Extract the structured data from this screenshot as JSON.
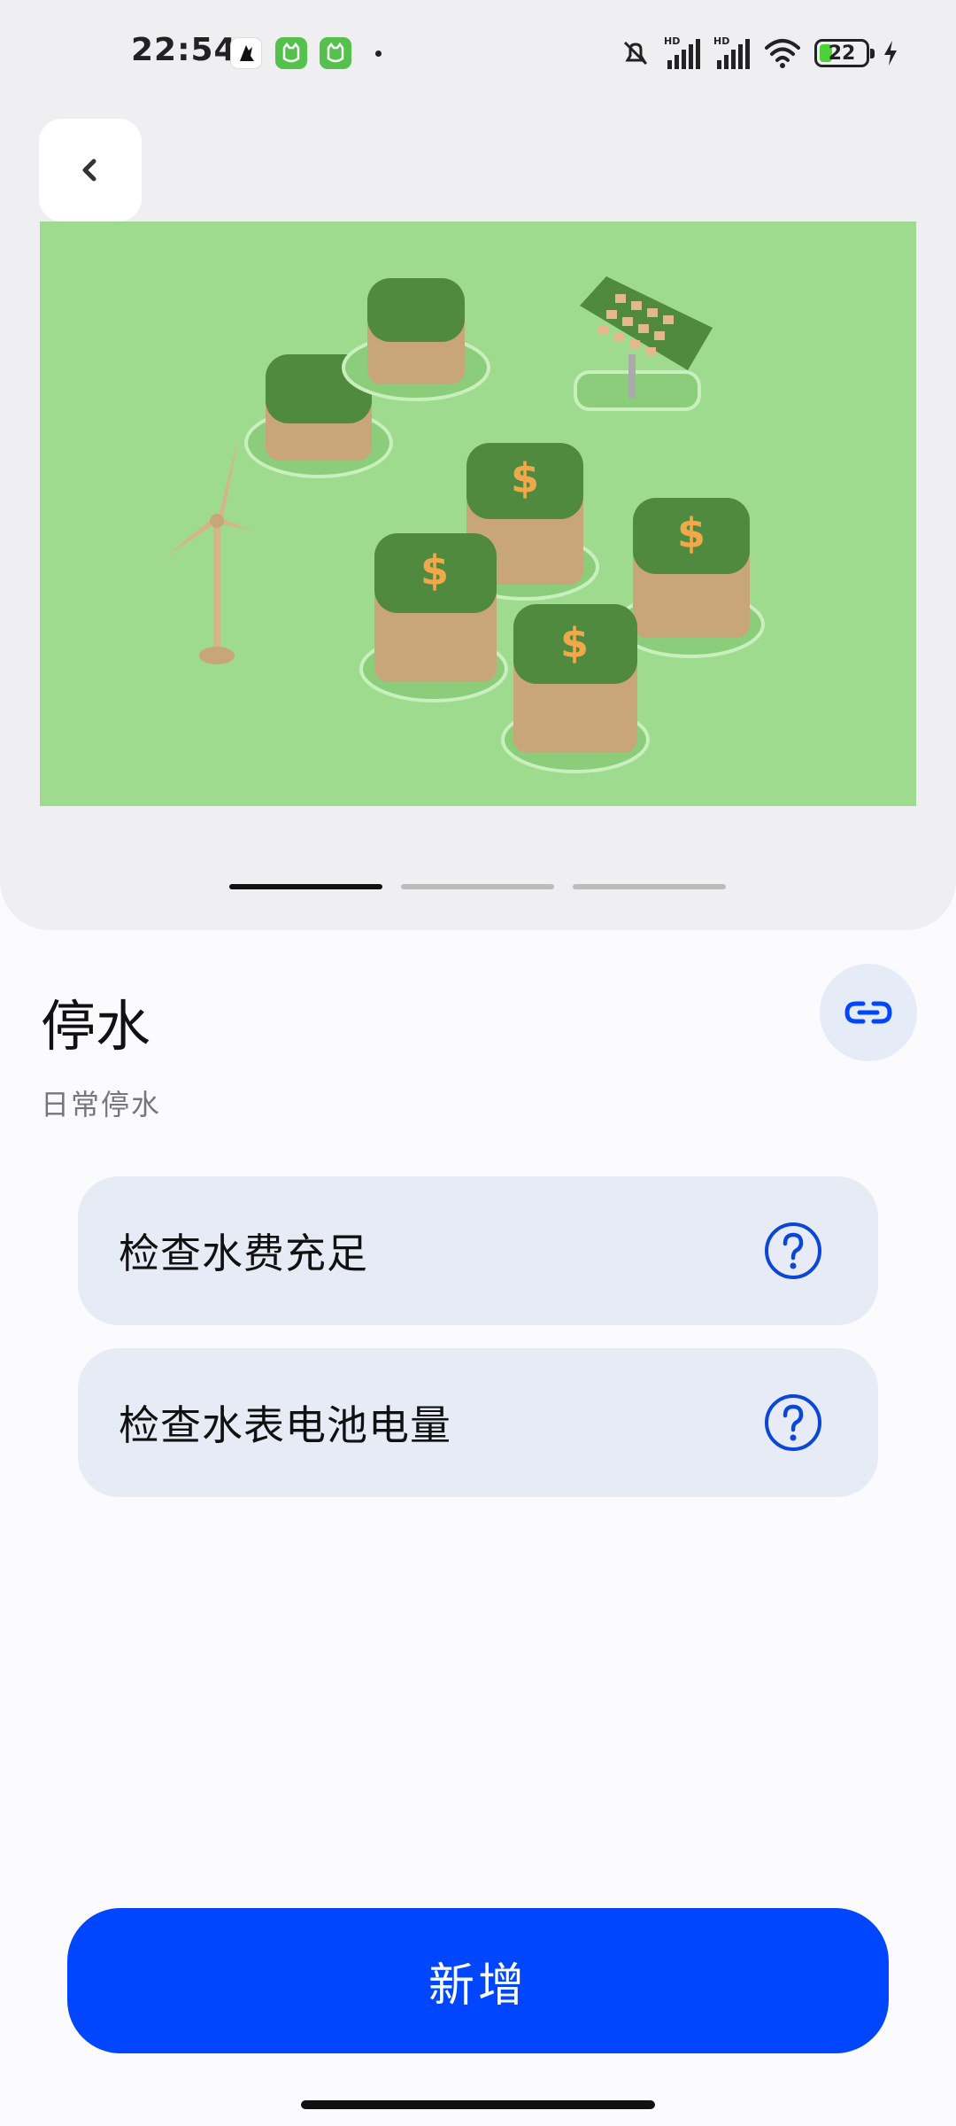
{
  "status_bar": {
    "time": "22:54",
    "battery_level": "22",
    "icons": [
      "white-app-icon",
      "green-cat-app-icon",
      "green-cat-app-icon",
      "mute-icon",
      "hd-signal-icon",
      "hd-signal-icon",
      "wifi-icon",
      "battery-icon",
      "charging-icon"
    ]
  },
  "header": {
    "back_icon": "chevron-left-icon"
  },
  "carousel": {
    "image": "isometric green energy illustration",
    "page_count": 3,
    "active_page": 1
  },
  "content": {
    "title": "停水",
    "subtitle": "日常停水",
    "link_icon": "link-icon"
  },
  "checks": [
    {
      "label": "检查水费充足",
      "icon": "question-circle-icon"
    },
    {
      "label": "检查水表电池电量",
      "icon": "question-circle-icon"
    }
  ],
  "footer": {
    "add_label": "新增"
  },
  "colors": {
    "accent": "#0046FF",
    "item_bg": "#E6EBF5",
    "panel_bg": "#EFEFF1",
    "hero_bg": "#9FDB8E"
  }
}
